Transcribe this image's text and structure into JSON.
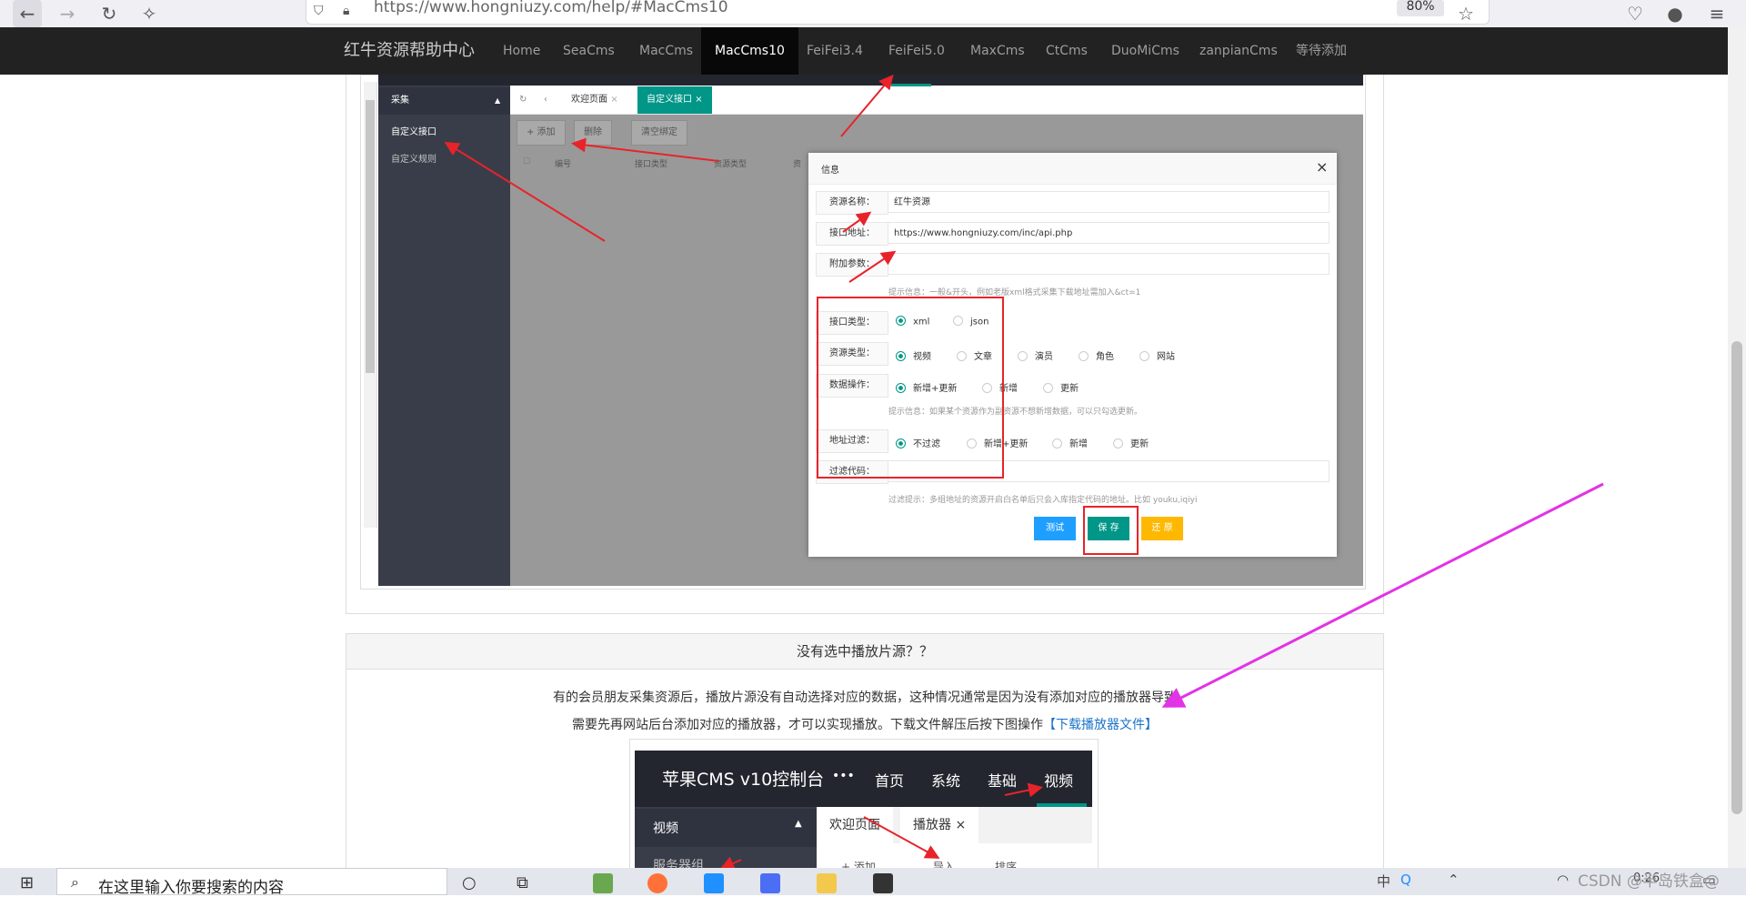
{
  "browser": {
    "url": "https://www.hongniuzy.com/help/#MacCms10",
    "zoom": "80%"
  },
  "site_nav": {
    "brand": "红牛资源帮助中心",
    "items": [
      "Home",
      "SeaCms",
      "MacCms",
      "MacCms10",
      "FeiFei3.4",
      "FeiFei5.0",
      "MaxCms",
      "CtCms",
      "DuoMiCms",
      "zanpianCms",
      "等待添加"
    ],
    "active": "MacCms10"
  },
  "screenshot1": {
    "sidebar": {
      "header": "采集",
      "items": [
        "自定义接口",
        "自定义规则"
      ]
    },
    "tabs": [
      "欢迎页面",
      "自定义接口"
    ],
    "toolbar": [
      "+ 添加",
      "删除",
      "清空绑定"
    ],
    "table_headers": [
      "编号",
      "接口类型",
      "资源类型",
      "资"
    ],
    "modal": {
      "title": "信息",
      "close": "×",
      "fields": {
        "name_label": "资源名称：",
        "name_value": "红牛资源",
        "api_label": "接口地址：",
        "api_value": "https://www.hongniuzy.com/inc/api.php",
        "param_label": "附加参数：",
        "param_value": "",
        "param_tip": "提示信息：一般&开头，例如老版xml格式采集下载地址需加入&ct=1",
        "api_type_label": "接口类型：",
        "api_type_options": [
          "xml",
          "json"
        ],
        "res_type_label": "资源类型：",
        "res_type_options": [
          "视频",
          "文章",
          "演员",
          "角色",
          "网站"
        ],
        "data_op_label": "数据操作：",
        "data_op_options": [
          "新增+更新",
          "新增",
          "更新"
        ],
        "data_op_tip": "提示信息：如果某个资源作为副资源不想新增数据，可以只勾选更新。",
        "filter_label": "地址过滤：",
        "filter_options": [
          "不过滤",
          "新增+更新",
          "新增",
          "更新"
        ],
        "filter_code_label": "过滤代码：",
        "filter_tip": "过滤提示：多组地址的资源开启白名单后只会入库指定代码的地址。比如 youku,iqiyi"
      },
      "buttons": [
        "测试",
        "保 存",
        "还 原"
      ]
    }
  },
  "panel2": {
    "title": "没有选中播放片源？？",
    "line1": "有的会员朋友采集资源后，播放片源没有自动选择对应的数据，这种情况通常是因为没有添加对应的播放器导致",
    "line2": "需要先再网站后台添加对应的播放器，才可以实现播放。下载文件解压后按下图操作",
    "link": "【下载播放器文件】"
  },
  "screenshot2": {
    "brand": "苹果CMS v10控制台",
    "dots": "•••",
    "nav": [
      "首页",
      "系统",
      "基础",
      "视频"
    ],
    "side_header": "视频",
    "side_item": "服务器组",
    "tabs": [
      "欢迎页面",
      "播放器 ×"
    ],
    "buttons": [
      "+ 添加",
      "导入",
      "排序"
    ]
  },
  "taskbar": {
    "search_placeholder": "在这里输入你要搜索的内容",
    "time": "0:26",
    "lang": "中",
    "watermark": "CSDN @半岛铁盒@"
  },
  "colors": {
    "accent": "#009688",
    "annotation_red": "#e8232a",
    "annotation_magenta": "#e233e6",
    "nav_bg": "#222222",
    "save_button": "#009688",
    "test_button": "#1e9fff",
    "reset_button": "#ffb800"
  }
}
